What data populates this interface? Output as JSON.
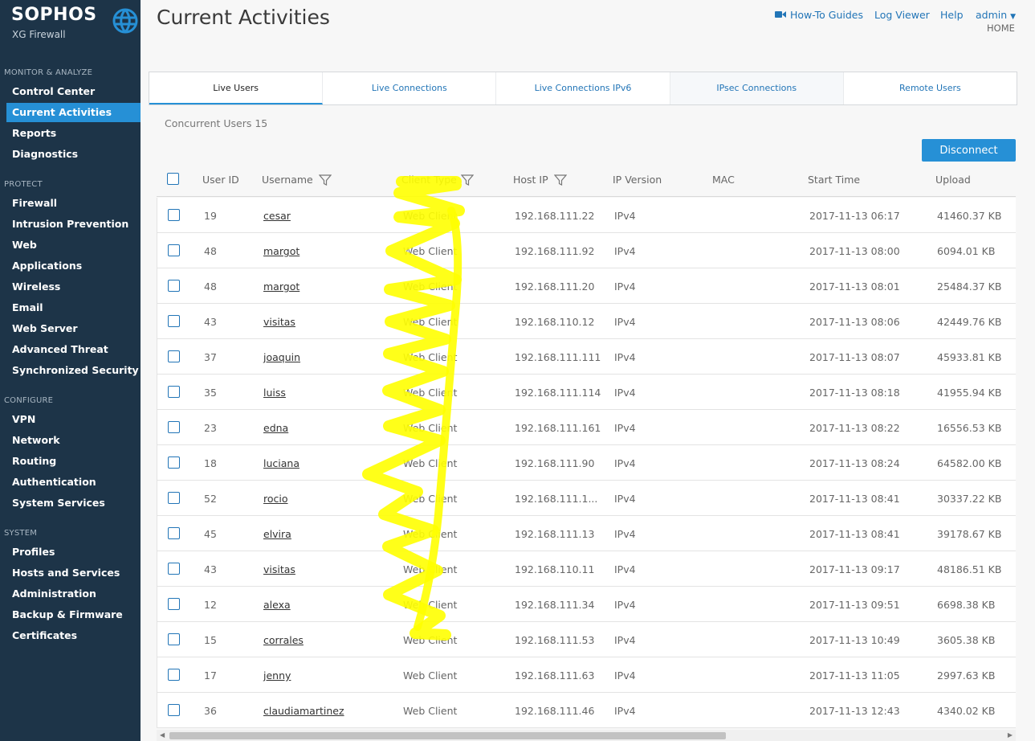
{
  "brand": {
    "name": "SOPHOS",
    "product": "XG Firewall"
  },
  "sidebar": {
    "sections": [
      {
        "title": "MONITOR & ANALYZE",
        "items": [
          "Control Center",
          "Current Activities",
          "Reports",
          "Diagnostics"
        ]
      },
      {
        "title": "PROTECT",
        "items": [
          "Firewall",
          "Intrusion Prevention",
          "Web",
          "Applications",
          "Wireless",
          "Email",
          "Web Server",
          "Advanced Threat",
          "Synchronized Security"
        ]
      },
      {
        "title": "CONFIGURE",
        "items": [
          "VPN",
          "Network",
          "Routing",
          "Authentication",
          "System Services"
        ]
      },
      {
        "title": "SYSTEM",
        "items": [
          "Profiles",
          "Hosts and Services",
          "Administration",
          "Backup & Firmware",
          "Certificates"
        ]
      }
    ],
    "active": "Current Activities"
  },
  "header": {
    "title": "Current Activities",
    "how_to": "How-To Guides",
    "log_viewer": "Log Viewer",
    "help": "Help",
    "admin": "admin",
    "home": "HOME"
  },
  "tabs": [
    "Live Users",
    "Live Connections",
    "Live Connections IPv6",
    "IPsec Connections",
    "Remote Users"
  ],
  "active_tab": "Live Users",
  "concurrent_label": "Concurrent Users",
  "concurrent_count": "15",
  "disconnect_label": "Disconnect",
  "columns": [
    "User ID",
    "Username",
    "Client Type",
    "Host IP",
    "IP Version",
    "MAC",
    "Start Time",
    "Upload"
  ],
  "rows": [
    {
      "id": "19",
      "user": "cesar",
      "client": "Web Client",
      "ip": "192.168.111.22",
      "ver": "IPv4",
      "mac": "",
      "start": "2017-11-13 06:17",
      "upload": "41460.37 KB"
    },
    {
      "id": "48",
      "user": "margot",
      "client": "Web Client",
      "ip": "192.168.111.92",
      "ver": "IPv4",
      "mac": "",
      "start": "2017-11-13 08:00",
      "upload": "6094.01 KB"
    },
    {
      "id": "48",
      "user": "margot",
      "client": "Web Client",
      "ip": "192.168.111.20",
      "ver": "IPv4",
      "mac": "",
      "start": "2017-11-13 08:01",
      "upload": "25484.37 KB"
    },
    {
      "id": "43",
      "user": "visitas",
      "client": "Web Client",
      "ip": "192.168.110.12",
      "ver": "IPv4",
      "mac": "",
      "start": "2017-11-13 08:06",
      "upload": "42449.76 KB"
    },
    {
      "id": "37",
      "user": "joaquin",
      "client": "Web Client",
      "ip": "192.168.111.111",
      "ver": "IPv4",
      "mac": "",
      "start": "2017-11-13 08:07",
      "upload": "45933.81 KB"
    },
    {
      "id": "35",
      "user": "luiss",
      "client": "Web Client",
      "ip": "192.168.111.114",
      "ver": "IPv4",
      "mac": "",
      "start": "2017-11-13 08:18",
      "upload": "41955.94 KB"
    },
    {
      "id": "23",
      "user": "edna",
      "client": "Web Client",
      "ip": "192.168.111.161",
      "ver": "IPv4",
      "mac": "",
      "start": "2017-11-13 08:22",
      "upload": "16556.53 KB"
    },
    {
      "id": "18",
      "user": "luciana",
      "client": "Web Client",
      "ip": "192.168.111.90",
      "ver": "IPv4",
      "mac": "",
      "start": "2017-11-13 08:24",
      "upload": "64582.00 KB"
    },
    {
      "id": "52",
      "user": "rocio",
      "client": "Web Client",
      "ip": "192.168.111.1...",
      "ver": "IPv4",
      "mac": "",
      "start": "2017-11-13 08:41",
      "upload": "30337.22 KB"
    },
    {
      "id": "45",
      "user": "elvira",
      "client": "Web Client",
      "ip": "192.168.111.13",
      "ver": "IPv4",
      "mac": "",
      "start": "2017-11-13 08:41",
      "upload": "39178.67 KB"
    },
    {
      "id": "43",
      "user": "visitas",
      "client": "Web Client",
      "ip": "192.168.110.11",
      "ver": "IPv4",
      "mac": "",
      "start": "2017-11-13 09:17",
      "upload": "48186.51 KB"
    },
    {
      "id": "12",
      "user": "alexa",
      "client": "Web Client",
      "ip": "192.168.111.34",
      "ver": "IPv4",
      "mac": "",
      "start": "2017-11-13 09:51",
      "upload": "6698.38 KB"
    },
    {
      "id": "15",
      "user": "corrales",
      "client": "Web Client",
      "ip": "192.168.111.53",
      "ver": "IPv4",
      "mac": "",
      "start": "2017-11-13 10:49",
      "upload": "3605.38 KB"
    },
    {
      "id": "17",
      "user": "jenny",
      "client": "Web Client",
      "ip": "192.168.111.63",
      "ver": "IPv4",
      "mac": "",
      "start": "2017-11-13 11:05",
      "upload": "2997.63 KB"
    },
    {
      "id": "36",
      "user": "claudiamartinez",
      "client": "Web Client",
      "ip": "192.168.111.46",
      "ver": "IPv4",
      "mac": "",
      "start": "2017-11-13 12:43",
      "upload": "4340.02 KB"
    }
  ],
  "colors": {
    "sidebar_bg": "#1d3448",
    "accent": "#2690d6",
    "link": "#2275b7",
    "highlight": "#ffff00"
  }
}
